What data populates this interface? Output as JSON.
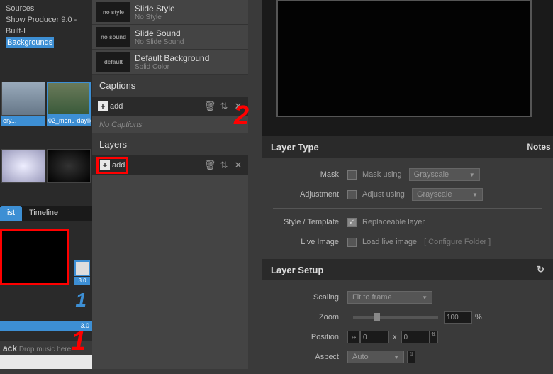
{
  "left": {
    "tree": [
      "Sources",
      "Show Producer 9.0 - Built-I"
    ],
    "selected": "Backgrounds",
    "thumbs": [
      {
        "label": "ery..."
      },
      {
        "label": "02_menu-daylig..."
      }
    ],
    "tabs": {
      "list": "ist",
      "timeline": "Timeline"
    },
    "timeline": {
      "dur1": "3.0",
      "num": "1",
      "dur2": "3.0"
    },
    "track": {
      "label": "ack",
      "hint": "Drop music here."
    }
  },
  "mid": {
    "props": [
      {
        "swatch": "no style",
        "title": "Slide Style",
        "sub": "No Style"
      },
      {
        "swatch": "no sound",
        "title": "Slide Sound",
        "sub": "No Slide Sound"
      },
      {
        "swatch": "default",
        "title": "Default Background",
        "sub": "Solid Color"
      }
    ],
    "captions": {
      "header": "Captions",
      "add": "add",
      "empty": "No Captions"
    },
    "layers": {
      "header": "Layers",
      "add": "add"
    },
    "annotations": {
      "one": "1",
      "two": "2"
    }
  },
  "right": {
    "layerType": {
      "header": "Layer Type",
      "notes": "Notes",
      "mask": {
        "label": "Mask",
        "chk": "Mask using",
        "opt": "Grayscale"
      },
      "adjust": {
        "label": "Adjustment",
        "chk": "Adjust using",
        "opt": "Grayscale"
      },
      "style": {
        "label": "Style / Template",
        "chk": "Replaceable layer"
      },
      "live": {
        "label": "Live Image",
        "chk": "Load live image",
        "link": "[ Configure Folder ]"
      }
    },
    "layerSetup": {
      "header": "Layer Setup",
      "scaling": {
        "label": "Scaling",
        "opt": "Fit to frame"
      },
      "zoom": {
        "label": "Zoom",
        "val": "100",
        "pct": "%"
      },
      "position": {
        "label": "Position",
        "x": "0",
        "xlbl": "x",
        "y": "0"
      },
      "aspect": {
        "label": "Aspect",
        "opt": "Auto"
      }
    }
  }
}
